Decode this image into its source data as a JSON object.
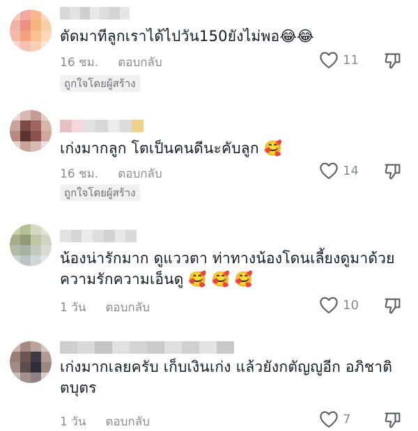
{
  "comments": [
    {
      "text": "ตัดมาทีลูกเราได้ไปวัน150ยังไม่พอ😂😂",
      "time": "16 ชม.",
      "reply_label": "ตอบกลับ",
      "creator_badge": "ถูกใจโดยผู้สร้าง",
      "likes": "11",
      "avatar_colors": [
        "#f6c9b8",
        "#f4a7a0",
        "#f9b68a",
        "#fbd6c0",
        "#f3b2a7",
        "#f08f84",
        "#f5b57e",
        "#f9cfa8",
        "#f5b9a8",
        "#f2a27d",
        "#f7c28f",
        "#fbd8b9",
        "#f8d3c6",
        "#f6c0ae",
        "#f9d0b3",
        "#fce6d6"
      ],
      "name_colors": [
        "#d9d9d9",
        "#e3e3e3",
        "#cfcfcf",
        "#e8e8e8",
        "#dddddd",
        "#d4d4d4",
        "#e6e6e6"
      ]
    },
    {
      "text": "เก่งมากลูก โตเป็นคนดีนะคับลูก 🥰",
      "time": "16 ชม.",
      "reply_label": "ตอบกลับ",
      "creator_badge": "ถูกใจโดยผู้สร้าง",
      "likes": "14",
      "avatar_colors": [
        "#e9dcd7",
        "#d8b8b0",
        "#c49c95",
        "#e2cfc9",
        "#c9a39b",
        "#7b4a45",
        "#9e6660",
        "#d6b5ad",
        "#b88980",
        "#5a3430",
        "#8a524b",
        "#cfa79d",
        "#e4d2cc",
        "#c9a29a",
        "#d7bbb3",
        "#ece0dc"
      ],
      "name_colors": [
        "#e7c1c5",
        "#f3d9dd",
        "#e2e2e2",
        "#d8d8d8",
        "#ececec",
        "#dcdcdc",
        "#f0d28a"
      ]
    },
    {
      "text": "น้องน่ารักมาก ดูแววตา ท่าทางน้องโดนเลี้ยงดูมาด้วยความรักความเอ็นดู 🥰 🥰 🥰",
      "time": "1 วัน",
      "reply_label": "ตอบกลับ",
      "likes": "10",
      "avatar_colors": [
        "#c9cfb0",
        "#b7bf94",
        "#d5d9bf",
        "#e3e6d6",
        "#a6ad88",
        "#8f9a76",
        "#bfc6a5",
        "#d0d5c0",
        "#b4b9a3",
        "#a7b1a8",
        "#c3c9bd",
        "#d8dcd2",
        "#cfd3cd",
        "#bcc2c1",
        "#d2d6d6",
        "#e4e6e6"
      ],
      "name_colors": [
        "#e3e3e3",
        "#d6d6d6",
        "#ebebeb",
        "#dedede",
        "#d2d2d2",
        "#e8e8e8",
        "#dadada"
      ]
    },
    {
      "text": "เก่งมากเลยครับ เก็บเงินเก่ง แล้วยังกตัญญูอีก อภิชาติตบุตร",
      "time": "1 วัน",
      "reply_label": "ตอบกลับ",
      "likes": "7",
      "avatar_colors": [
        "#c7b5ae",
        "#a48a83",
        "#b9a39b",
        "#d4c7c2",
        "#9b7f77",
        "#6d5650",
        "#3c3b44",
        "#b09a93",
        "#a08c86",
        "#5d4d4a",
        "#2d2f3a",
        "#9a8983",
        "#c8bcb7",
        "#a1918c",
        "#8d8184",
        "#d6cdca"
      ],
      "name_colors": [
        "#cfcfcf",
        "#dadada",
        "#c5c5c5",
        "#e1e1e1",
        "#d4d4d4",
        "#cbcbcb",
        "#dfdfdf",
        "#d0d0d0",
        "#e4e4e4",
        "#c9c9c9"
      ]
    }
  ]
}
